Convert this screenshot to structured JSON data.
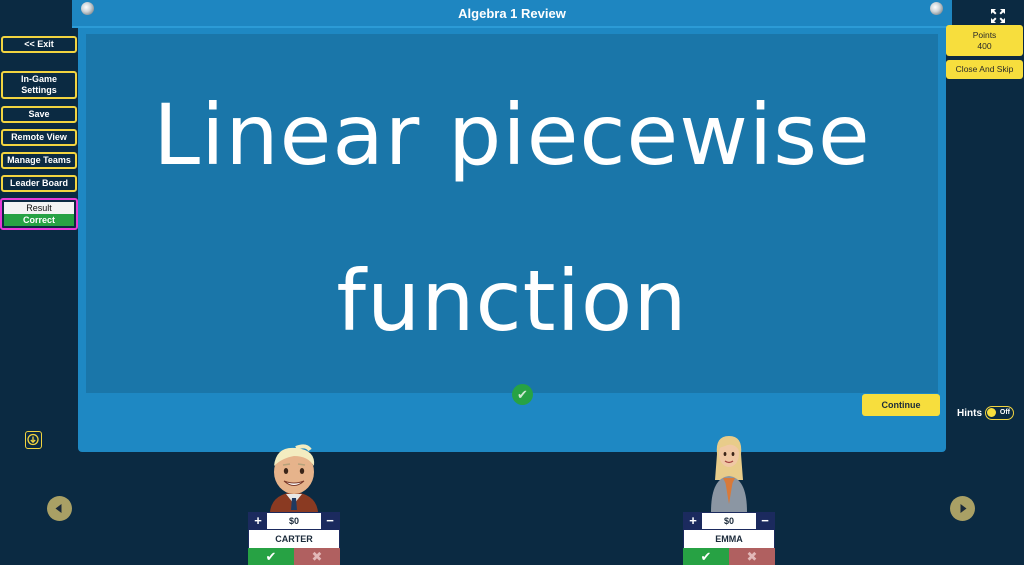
{
  "game": {
    "title": "Algebra 1 Review",
    "card_lines": [
      "Linear piecewise",
      "function"
    ],
    "continue_label": "Continue"
  },
  "left_menu": {
    "exit": "<< Exit",
    "settings_line1": "In-Game",
    "settings_line2": "Settings",
    "save": "Save",
    "remote_view": "Remote View",
    "manage_teams": "Manage Teams",
    "leader_board": "Leader Board",
    "result_label": "Result",
    "result_value": "Correct"
  },
  "right_menu": {
    "points_label": "Points",
    "points_value": "400",
    "close_skip": "Close And Skip"
  },
  "hints": {
    "label": "Hints",
    "state": "Off"
  },
  "players": [
    {
      "name": "CARTER",
      "score": "$0"
    },
    {
      "name": "EMMA",
      "score": "$0"
    }
  ],
  "colors": {
    "background": "#0b2a42",
    "board": "#1e88c3",
    "card": "#1a76a9",
    "accent_yellow": "#f7de3d",
    "correct_green": "#27a244",
    "wrong_red": "#b06060",
    "result_highlight": "#e83ad6"
  },
  "icons": {
    "expand": "expand-arrows-icon",
    "scroll": "arrow-down-icon",
    "prev": "triangle-left-icon",
    "next": "triangle-right-icon",
    "correct": "checkmark-icon",
    "wrong": "x-mark-icon"
  }
}
